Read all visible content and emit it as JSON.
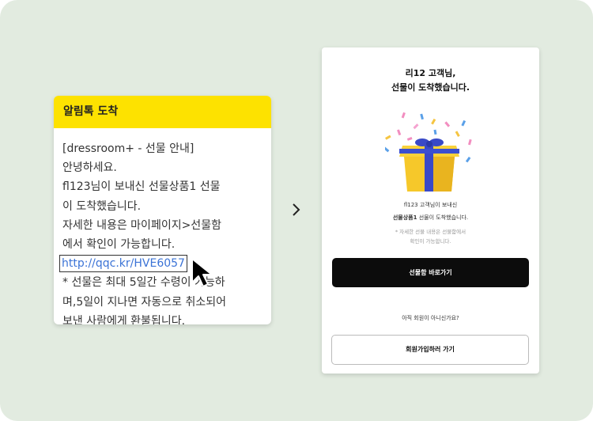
{
  "alimtalk": {
    "header": "알림톡 도착",
    "lines": [
      "[dressroom+ - 선물 안내]",
      "안녕하세요.",
      "fl123님이 보내신 선물상품1 선물",
      "이 도착했습니다.",
      "자세한 내용은 마이페이지>선물함",
      "에서 확인이 가능합니다."
    ],
    "link": "http://qqc.kr/HVE6057",
    "footer_lines": [
      "* 선물은 최대 5일간 수령이 가능하",
      "며,5일이 지나면 자동으로 취소되어",
      " 보낸 사람에게 환불됩니다."
    ]
  },
  "landing": {
    "title_line1": "리12 고객님,",
    "title_line2": "선물이 도착했습니다.",
    "msg_line1": "fl123 고객님이 보내신",
    "msg_bold": "선물상품1",
    "msg_rest": " 선물이 도착했습니다.",
    "note_line1": "* 자세한 선물 내용은 선물함에서",
    "note_line2": "확인이 가능합니다.",
    "primary_button": "선물함 바로가기",
    "question": "아직 회원이 아니신가요?",
    "secondary_button": "회원가입하러 가기"
  },
  "icons": {
    "transition_arrow": "chevron-right-icon",
    "pointer": "mouse-cursor-icon",
    "gift": "gift-box-icon"
  },
  "colors": {
    "kakao_yellow": "#fde200",
    "link_blue": "#3b73d6",
    "gift_yellow": "#f6c82a",
    "ribbon_blue": "#3949c7"
  }
}
